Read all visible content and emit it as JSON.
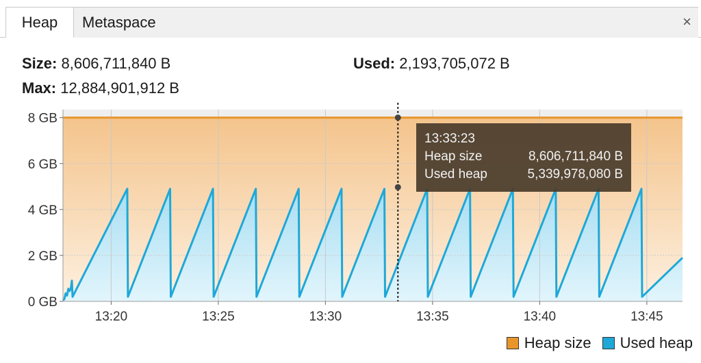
{
  "tabs": [
    {
      "label": "Heap",
      "active": true
    },
    {
      "label": "Metaspace",
      "active": false
    }
  ],
  "close_label": "×",
  "stats": {
    "size_label": "Size:",
    "size_value": "8,606,711,840 B",
    "used_label": "Used:",
    "used_value": "2,193,705,072 B",
    "max_label": "Max:",
    "max_value": "12,884,901,912 B"
  },
  "tooltip": {
    "time": "13:33:23",
    "rows": [
      {
        "label": "Heap size",
        "value": "8,606,711,840 B"
      },
      {
        "label": "Used heap",
        "value": "5,339,978,080 B"
      }
    ]
  },
  "colors": {
    "heap_size": "#e8962a",
    "used_heap": "#1ea8d8"
  },
  "chart_data": {
    "type": "area",
    "x_ticks": [
      "13:20",
      "13:25",
      "13:30",
      "13:35",
      "13:40",
      "13:45"
    ],
    "y_ticks": [
      "0 GB",
      "2 GB",
      "4 GB",
      "6 GB",
      "8 GB"
    ],
    "x_unit": "minutes",
    "x_range": [
      "13:17:45",
      "13:46:40"
    ],
    "ylim_gb": [
      0,
      8.35
    ],
    "heap_size_gb": 8.0,
    "used_heap_sawtooth": {
      "peaks": [
        {
          "t": "13:18:10",
          "gb": 0.9
        },
        {
          "t": "13:20:45",
          "gb": 4.9
        },
        {
          "t": "13:22:45",
          "gb": 4.9
        },
        {
          "t": "13:24:45",
          "gb": 4.9
        },
        {
          "t": "13:26:45",
          "gb": 4.9
        },
        {
          "t": "13:28:45",
          "gb": 4.9
        },
        {
          "t": "13:30:45",
          "gb": 4.9
        },
        {
          "t": "13:32:45",
          "gb": 4.9
        },
        {
          "t": "13:34:45",
          "gb": 4.9
        },
        {
          "t": "13:36:45",
          "gb": 4.9
        },
        {
          "t": "13:38:45",
          "gb": 4.9
        },
        {
          "t": "13:40:45",
          "gb": 4.9
        },
        {
          "t": "13:42:45",
          "gb": 4.9
        },
        {
          "t": "13:44:45",
          "gb": 4.9
        }
      ],
      "trough_gb": 0.2,
      "end": {
        "t": "13:46:40",
        "gb": 1.9
      }
    },
    "cursor_time": "13:33:23",
    "cursor_values_gb": {
      "heap_size": 8.0,
      "used_heap": 4.97
    },
    "series": [
      {
        "name": "Heap size"
      },
      {
        "name": "Used heap"
      }
    ],
    "grid": true,
    "legend_position": "bottom-right"
  }
}
